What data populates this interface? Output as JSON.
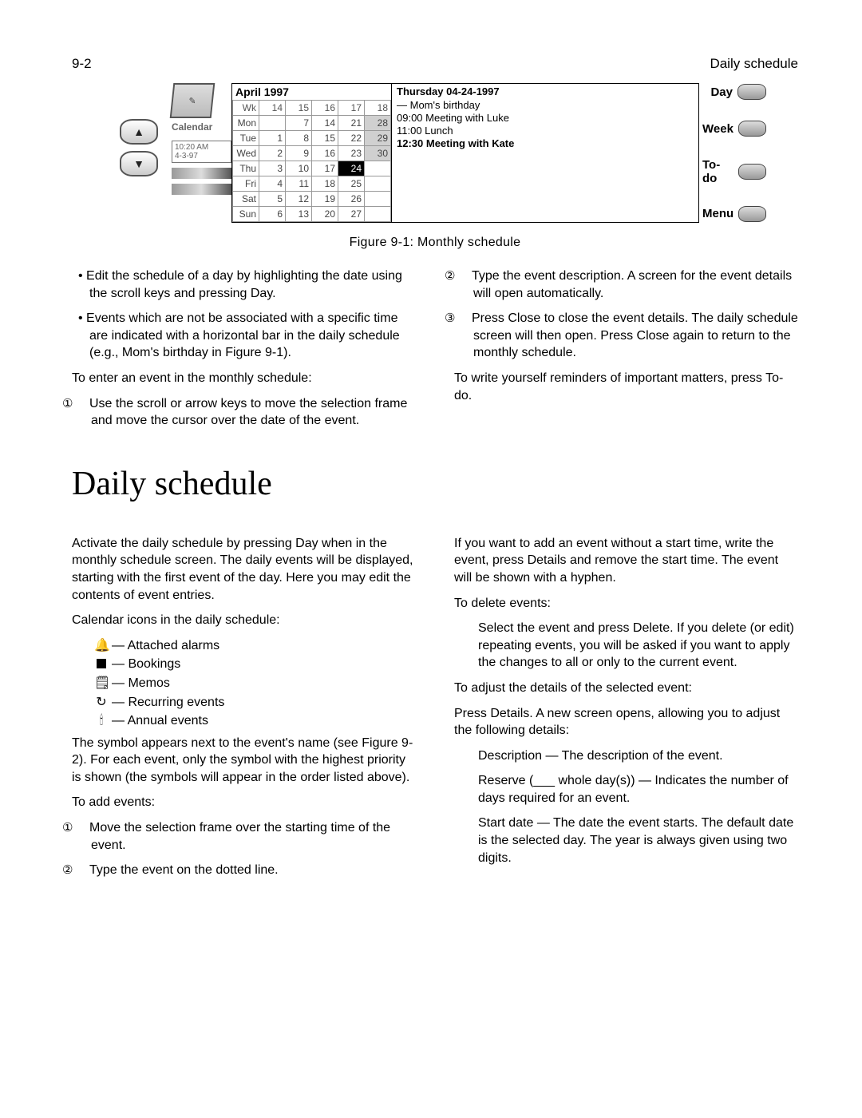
{
  "page_header": {
    "left": "9-2",
    "right": "Daily schedule"
  },
  "shot": {
    "nav_up_glyph": "▲",
    "nav_down_glyph": "▼",
    "notebook_glyph": "✎",
    "calendar_label": "Calendar",
    "time_line1": "10:20 AM",
    "time_line2": "4-3-97",
    "month_title": "April 1997",
    "week_row": [
      "Wk",
      "14",
      "15",
      "16",
      "17",
      "18"
    ],
    "rows": [
      [
        "Mon",
        "",
        "7",
        "14",
        "21",
        "28"
      ],
      [
        "Tue",
        "1",
        "8",
        "15",
        "22",
        "29"
      ],
      [
        "Wed",
        "2",
        "9",
        "16",
        "23",
        "30"
      ],
      [
        "Thu",
        "3",
        "10",
        "17",
        "24",
        ""
      ],
      [
        "Fri",
        "4",
        "11",
        "18",
        "25",
        ""
      ],
      [
        "Sat",
        "5",
        "12",
        "19",
        "26",
        ""
      ],
      [
        "Sun",
        "6",
        "13",
        "20",
        "27",
        ""
      ]
    ],
    "selected_cell": "24",
    "shaded_col_note": "wk18",
    "day_header": "Thursday  04-24-1997",
    "events": [
      {
        "text": "—  Mom's birthday",
        "bold": false
      },
      {
        "text": "09:00 Meeting with Luke",
        "bold": false
      },
      {
        "text": "11:00 Lunch",
        "bold": false
      },
      {
        "text": "12:30 Meeting with Kate",
        "bold": true
      }
    ],
    "soft": [
      "Day",
      "Week",
      "To-do",
      "Menu"
    ]
  },
  "figure_caption": "Figure 9-1: Monthly schedule",
  "upper_left": {
    "b1": "Edit the schedule of a day by highlighting the date using the scroll keys and pressing Day.",
    "b2": "Events which are not be associated with a specific time are indicated with a horizontal bar in the daily schedule (e.g., Mom's birthday in Figure 9-1).",
    "p1": "To enter an event in the monthly schedule:",
    "n1": "Use the scroll or arrow keys to move the selection frame and move the cursor over the date of the event."
  },
  "upper_right": {
    "n2": "Type the event description. A screen for the event details will open automatically.",
    "n3": "Press Close to close the event details. The daily schedule screen will then open. Press Close again to return to the monthly schedule.",
    "p1": "To write yourself reminders of important matters, press To-do."
  },
  "section_title": "Daily schedule",
  "lower_left": {
    "p1": "Activate the daily schedule by pressing Day when in the monthly schedule screen. The daily events will be displayed, starting with the first event of the day. Here you may edit the contents of event entries.",
    "p2": "Calendar icons in the daily schedule:",
    "legend": [
      {
        "glyph": "🔔",
        "label": "— Attached alarms"
      },
      {
        "glyph": "BOX",
        "label": "— Bookings"
      },
      {
        "glyph": "🗒",
        "label": "— Memos"
      },
      {
        "glyph": "↻",
        "label": "— Recurring events"
      },
      {
        "glyph": "🕯",
        "label": "— Annual events"
      }
    ],
    "p3": "The symbol appears next to the event's name (see Figure 9-2). For each event, only the symbol with the highest priority is shown (the symbols will appear in the order listed above).",
    "p4": "To add events:",
    "n1": "Move the selection frame over the starting time of the event.",
    "n2": "Type the event on the dotted line."
  },
  "lower_right": {
    "p1": "If you want to add an event without a start time, write the event, press Details and remove the start time. The event will be shown with a hyphen.",
    "p2": "To delete events:",
    "p2b": "Select the event and press Delete. If you delete (or edit) repeating events, you will be asked if you want to apply the changes to all or only to the current event.",
    "p3": "To adjust the details of the selected event:",
    "p4": "Press Details. A new screen opens, allowing you to adjust the following details:",
    "d1": "Description — The description of the event.",
    "d2": "Reserve (___ whole day(s)) — Indicates the number of days required for an event.",
    "d3": "Start date — The date the event starts. The default date is the selected day. The year is always given using two digits."
  },
  "markers": {
    "m1": "①",
    "m2": "②",
    "m3": "③"
  }
}
